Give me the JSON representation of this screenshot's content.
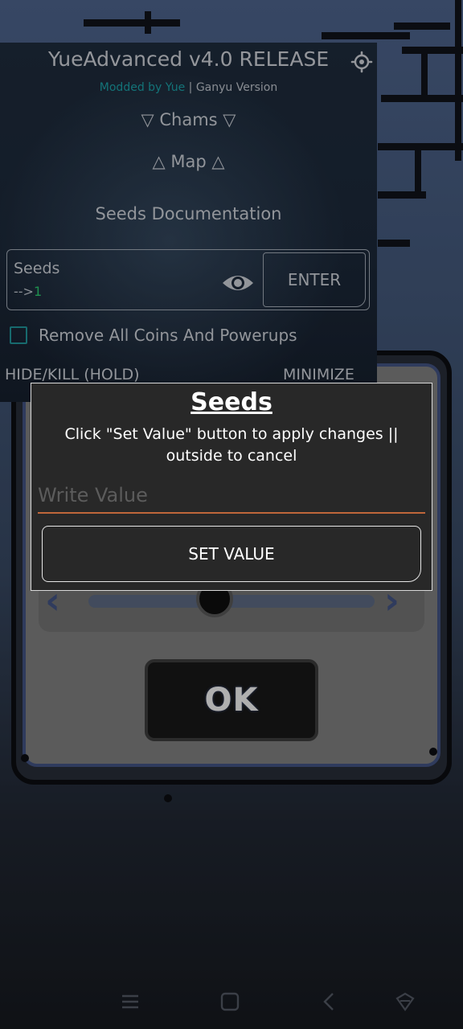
{
  "game": {
    "ok_label": "OK"
  },
  "menu": {
    "title": "YueAdvanced v4.0 RELEASE",
    "subtitle_accent": "Modded by Yue",
    "subtitle_rest": " | Ganyu Version",
    "chams_label": "▽ Chams ▽",
    "map_label": "△ Map △",
    "seeds_doc_label": "Seeds Documentation",
    "seeds_label": "Seeds",
    "seeds_prefix": "-->",
    "seeds_value": "1",
    "enter_label": "ENTER",
    "checkbox_label": "Remove All Coins And Powerups",
    "checkbox_checked": false,
    "hide_label": "HIDE/KILL (HOLD)",
    "minimize_label": "MINIMIZE",
    "accent_color": "#1a9aa0",
    "value_color": "#29c06a"
  },
  "dialog": {
    "title": "Seeds",
    "message": "Click \"Set Value\" button to apply changes || outside to cancel",
    "input_placeholder": "Write Value",
    "input_value": "",
    "set_button_label": "SET VALUE",
    "underline_color": "#c0663a"
  },
  "navbar": {
    "icons": [
      "menu-icon",
      "home-icon",
      "back-icon",
      "assistant-icon"
    ]
  }
}
